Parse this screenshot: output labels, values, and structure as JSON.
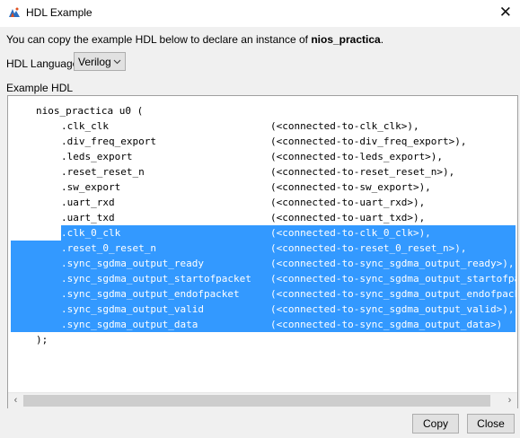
{
  "window": {
    "title": "HDL Example",
    "close_glyph": "✕"
  },
  "intro": {
    "text": "You can copy the example HDL below to declare an instance of ",
    "instance_name": "nios_practica",
    "suffix": "."
  },
  "hdl_language": {
    "label": "HDL Language:",
    "selected": "Verilog"
  },
  "example": {
    "label": "Example HDL",
    "module_line": "nios_practica u0 (",
    "ports": [
      {
        "signal": ".clk_clk",
        "conn": "(<connected-to-clk_clk>),",
        "selected": false
      },
      {
        "signal": ".div_freq_export",
        "conn": "(<connected-to-div_freq_export>),",
        "selected": false
      },
      {
        "signal": ".leds_export",
        "conn": "(<connected-to-leds_export>),",
        "selected": false
      },
      {
        "signal": ".reset_reset_n",
        "conn": "(<connected-to-reset_reset_n>),",
        "selected": false
      },
      {
        "signal": ".sw_export",
        "conn": "(<connected-to-sw_export>),",
        "selected": false
      },
      {
        "signal": ".uart_rxd",
        "conn": "(<connected-to-uart_rxd>),",
        "selected": false
      },
      {
        "signal": ".uart_txd",
        "conn": "(<connected-to-uart_txd>),",
        "selected": false
      },
      {
        "signal": ".clk_0_clk",
        "conn": "(<connected-to-clk_0_clk>),",
        "selected": "partial"
      },
      {
        "signal": ".reset_0_reset_n",
        "conn": "(<connected-to-reset_0_reset_n>),",
        "selected": true
      },
      {
        "signal": ".sync_sgdma_output_ready",
        "conn": "(<connected-to-sync_sgdma_output_ready>),",
        "selected": true
      },
      {
        "signal": ".sync_sgdma_output_startofpacket",
        "conn": "(<connected-to-sync_sgdma_output_startofpacket>),",
        "selected": true
      },
      {
        "signal": ".sync_sgdma_output_endofpacket",
        "conn": "(<connected-to-sync_sgdma_output_endofpacket>),",
        "selected": true
      },
      {
        "signal": ".sync_sgdma_output_valid",
        "conn": "(<connected-to-sync_sgdma_output_valid>),",
        "selected": true
      },
      {
        "signal": ".sync_sgdma_output_data",
        "conn": "(<connected-to-sync_sgdma_output_data>)",
        "selected": true
      }
    ],
    "close_line": ");"
  },
  "buttons": {
    "copy": "Copy",
    "close": "Close"
  },
  "colors": {
    "selection": "#3399ff"
  },
  "icons": {
    "app": "quartus-app-icon",
    "dropdown": "chevron-down-icon",
    "scroll_left": "scroll-left-arrow-icon",
    "scroll_right": "scroll-right-arrow-icon"
  }
}
